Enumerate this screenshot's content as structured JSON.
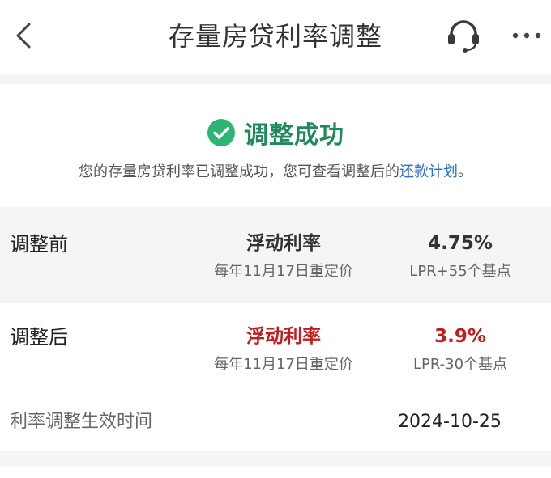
{
  "header": {
    "title": "存量房贷利率调整",
    "icons": {
      "back": "chevron-left-icon",
      "service": "headset-icon",
      "more": "more-dots-icon"
    }
  },
  "result": {
    "title": "调整成功",
    "desc_prefix": "您的存量房贷利率已调整成功，您可查看调整后的",
    "desc_link": "还款计划",
    "desc_suffix": "。",
    "accent_color": "#1f8a5a",
    "link_color": "#2a6fd6"
  },
  "rates": {
    "before": {
      "label": "调整前",
      "type": "浮动利率",
      "reprice": "每年11月17日重定价",
      "rate": "4.75%",
      "lpr": "LPR+55个基点"
    },
    "after": {
      "label": "调整后",
      "type": "浮动利率",
      "reprice": "每年11月17日重定价",
      "rate": "3.9%",
      "lpr": "LPR-30个基点",
      "highlight_color": "#c41c1c"
    },
    "effective": {
      "label": "利率调整生效时间",
      "date": "2024-10-25"
    }
  }
}
